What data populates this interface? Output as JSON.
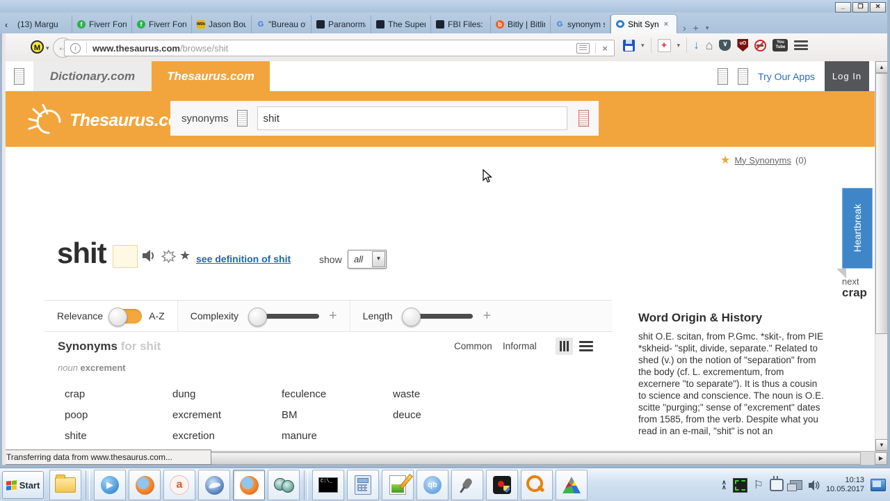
{
  "colors": {
    "accent_orange": "#f2a53c",
    "link_blue": "#1a66b3",
    "heartbreak_blue": "#3f86c8",
    "login_bg": "#55565a"
  },
  "window": {
    "minimize": "_",
    "maximize": "❐",
    "close": "✕"
  },
  "tabs": [
    {
      "label": "(13) Margu"
    },
    {
      "label": "Fiverr Foru"
    },
    {
      "label": "Fiverr Foru"
    },
    {
      "label": "Jason Bour"
    },
    {
      "label": "\"Bureau of"
    },
    {
      "label": "Paranorma"
    },
    {
      "label": "The Supern"
    },
    {
      "label": "FBI Files: T"
    },
    {
      "label": "Bitly | Bitlin"
    },
    {
      "label": "synonym s"
    },
    {
      "label": "Shit Syn"
    }
  ],
  "tab_extras": {
    "scroll_left": "‹",
    "scroll_right": "›",
    "new_tab": "+",
    "list_tabs": "▾",
    "close_tab": "×",
    "imdb": "IMDb",
    "g": "G",
    "f": "f",
    "b": "b"
  },
  "navbar": {
    "m_badge": "M",
    "back": "←",
    "url_host": "www.thesaurus.com",
    "url_path": "/browse/shit",
    "stop": "×",
    "download": "↓",
    "home": "⌂",
    "pocket": "∨",
    "ublock": "uO",
    "youtube_line1": "You",
    "youtube_line2": "Tube",
    "health": "+"
  },
  "site_header": {
    "dictionary": "Dictionary.com",
    "thesaurus": "Thesaurus.com",
    "try_our_apps": "Try Our Apps",
    "log_in": "Log In"
  },
  "search": {
    "logo": "Thesaurus.com",
    "category": "synonyms",
    "value": "shit"
  },
  "page": {
    "my_synonyms": {
      "star": "★",
      "label": "My Synonyms",
      "count": "(0)"
    },
    "headword": "shit",
    "star": "★",
    "see_definition": "see definition of shit",
    "show_label": "show",
    "show_value": "all",
    "select_arrow": "▼",
    "filters": {
      "relevance": "Relevance",
      "az": "A-Z",
      "complexity": "Complexity",
      "length": "Length",
      "plus": "+"
    },
    "synonyms": {
      "title": "Synonyms",
      "for_text": "for shit",
      "pos": "noun",
      "sense": "excrement",
      "common": "Common",
      "informal": "Informal"
    },
    "words": [
      "crap",
      "dung",
      "feculence",
      "waste",
      "poop",
      "excrement",
      "BM",
      "deuce",
      "shite",
      "excretion",
      "manure"
    ],
    "word_origin": {
      "title": "Word Origin & History",
      "body": "shit O.E. scitan, from P.Gmc. *skit-, from PIE *skheid- \"split, divide, separate.\" Related to shed (v.) on the notion of \"separation\" from the body (cf. L. excrementum, from excernere \"to separate\"). It is thus a cousin to science and conscience. The noun is O.E. scitte \"purging;\" sense of \"excrement\" dates from 1585, from the verb. Despite what you read in an e-mail, \"shit\" is not an"
    },
    "heartbreak": "Heartbreak",
    "next_label": "next",
    "next_word": "crap",
    "scroll": {
      "up": "▲",
      "down": "▼",
      "right": "▶"
    }
  },
  "statusbar": {
    "text": "Transferring data from www.thesaurus.com..."
  },
  "taskbar": {
    "start": "Start",
    "wmp_play": "▶",
    "amigo": "a",
    "cmd": "C:\\_",
    "qb": "qb",
    "tray_chevron": "∧",
    "tray_flag": "⚐",
    "clock_time": "10:13",
    "clock_date": "10.05.2017"
  }
}
